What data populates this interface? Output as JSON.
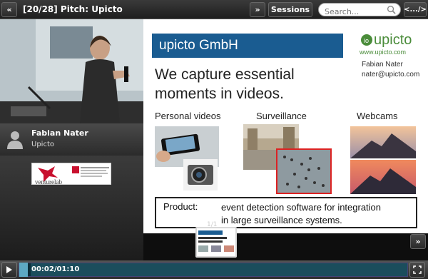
{
  "header": {
    "prev_label": "«",
    "title": "[20/28] Pitch: Upicto",
    "next_label": "»",
    "sessions_label": "Sessions",
    "search_placeholder": "Search...",
    "share_label": "<.../>"
  },
  "speaker": {
    "name": "Fabian Nater",
    "organization": "Upicto"
  },
  "sponsor": {
    "logo_text": "venturelab"
  },
  "slide": {
    "company": "upicto GmbH",
    "logo_text": "upicto",
    "logo_url": "www.upicto.com",
    "contact_name": "Fabian Nater",
    "contact_email": "nater@upicto.com",
    "headline_line1": "We capture essential",
    "headline_line2": "moments in videos.",
    "columns": [
      "Personal videos",
      "Surveillance",
      "Webcams"
    ],
    "product_label": "Product:",
    "product_text_line1": "event detection software for integration",
    "product_text_line2": "in large surveillance systems."
  },
  "thumbnail": {
    "count": "1/1"
  },
  "player": {
    "time": "00:02/01:10",
    "progress_fraction": 0.029
  },
  "colors": {
    "slide_banner": "#1a5c91",
    "logo_green": "#4a8c3a",
    "progress_track": "#1b4d5c",
    "progress_handle": "#5da9c3"
  }
}
